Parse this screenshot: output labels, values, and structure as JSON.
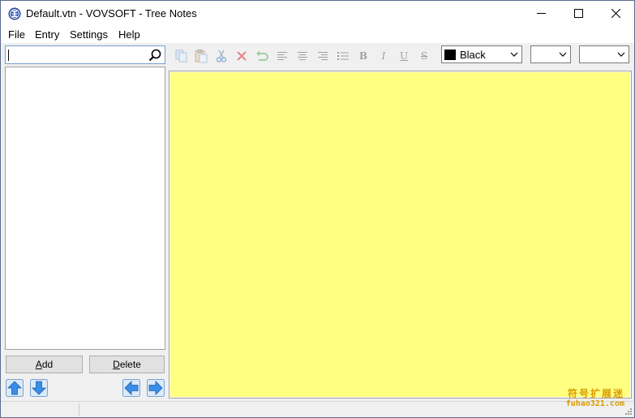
{
  "window": {
    "title": "Default.vtn - VOVSOFT - Tree Notes",
    "app_icon": "vovsoft-tree-notes-icon"
  },
  "menu": {
    "items": [
      {
        "label": "File"
      },
      {
        "label": "Entry"
      },
      {
        "label": "Settings"
      },
      {
        "label": "Help"
      }
    ]
  },
  "search": {
    "value": "",
    "placeholder": "",
    "icon": "search-icon"
  },
  "tree": {
    "items": []
  },
  "buttons": {
    "add_accel": "A",
    "add_rest": "dd",
    "delete_accel": "D",
    "delete_rest": "elete"
  },
  "nav_icons": [
    "move-up-icon",
    "move-down-icon",
    "move-left-icon",
    "move-right-icon"
  ],
  "toolbar": {
    "icons": [
      "copy-icon",
      "paste-icon",
      "cut-icon",
      "delete-icon",
      "undo-icon",
      "align-left-icon",
      "align-center-icon",
      "align-right-icon",
      "bullet-list-icon",
      "bold-icon",
      "italic-icon",
      "underline-icon",
      "strikethrough-icon"
    ],
    "bold_label": "B",
    "italic_label": "I",
    "underline_label": "U",
    "strike_label": "S",
    "color": {
      "label": "Black",
      "value": "#000000"
    },
    "font_family": "",
    "font_size": ""
  },
  "editor": {
    "content": "",
    "background": "#ffff80"
  },
  "watermark": {
    "line1": "符号扩展迷",
    "line2": "fuhao321.com"
  },
  "colors": {
    "accent": "#1e66c8",
    "editor_bg": "#ffff80",
    "toolbar_disabled": "#a0a0a0"
  }
}
